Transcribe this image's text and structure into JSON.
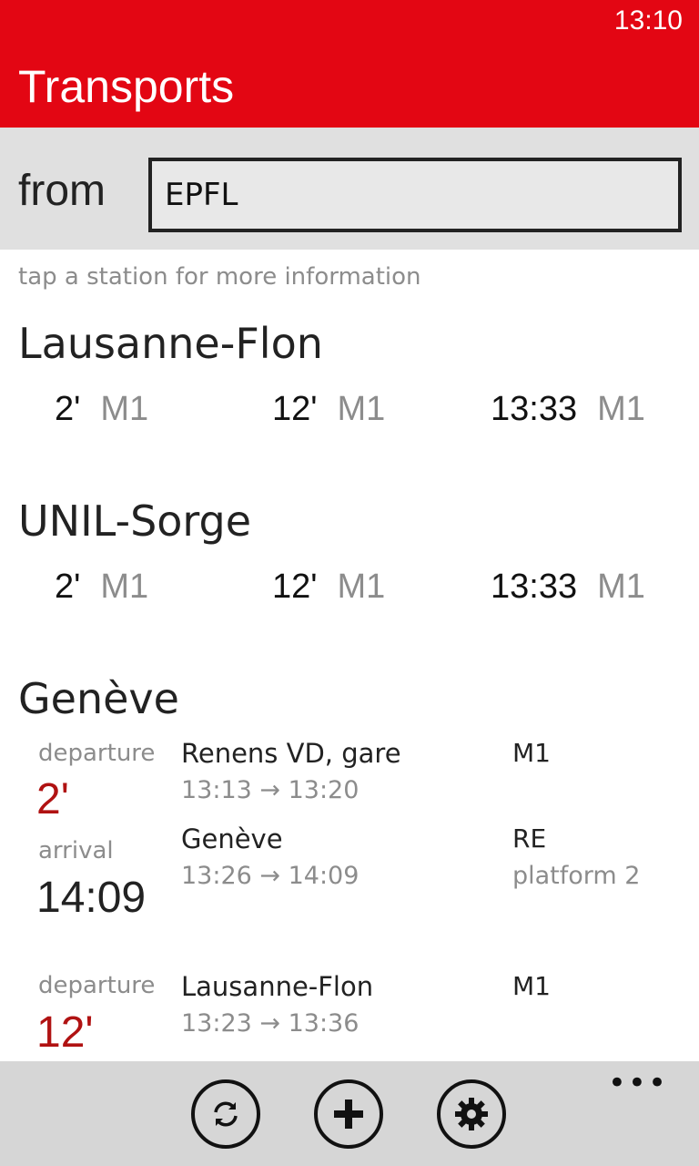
{
  "status_bar": {
    "time": "13:10"
  },
  "header": {
    "title": "Transports"
  },
  "from": {
    "label": "from",
    "value": "EPFL"
  },
  "hint": "tap a station for more information",
  "stations": [
    {
      "name": "Lausanne-Flon",
      "departures": [
        {
          "time": "2'",
          "line": "M1"
        },
        {
          "time": "12'",
          "line": "M1"
        },
        {
          "time": "13:33",
          "line": "M1"
        }
      ]
    },
    {
      "name": "UNIL-Sorge",
      "departures": [
        {
          "time": "2'",
          "line": "M1"
        },
        {
          "time": "12'",
          "line": "M1"
        },
        {
          "time": "13:33",
          "line": "M1"
        }
      ]
    }
  ],
  "geneve": {
    "name": "Genève",
    "connections": [
      {
        "departure_label": "departure",
        "departure_value": "2'",
        "arrival_label": "arrival",
        "arrival_value": "14:09",
        "legs": [
          {
            "station": "Renens VD, gare",
            "times": "13:13 → 13:20",
            "line": "M1",
            "platform": ""
          },
          {
            "station": "Genève",
            "times": "13:26 → 14:09",
            "line": "RE",
            "platform": "platform 2"
          }
        ]
      },
      {
        "departure_label": "departure",
        "departure_value": "12'",
        "legs": [
          {
            "station": "Lausanne-Flon",
            "times": "13:23 → 13:36",
            "line": "M1"
          }
        ]
      }
    ]
  },
  "app_bar": {
    "buttons": [
      {
        "icon": "refresh-icon"
      },
      {
        "icon": "add-icon"
      },
      {
        "icon": "settings-icon"
      }
    ],
    "more": "•••"
  },
  "colors": {
    "accent": "#e30613",
    "departure_red": "#b01212"
  }
}
